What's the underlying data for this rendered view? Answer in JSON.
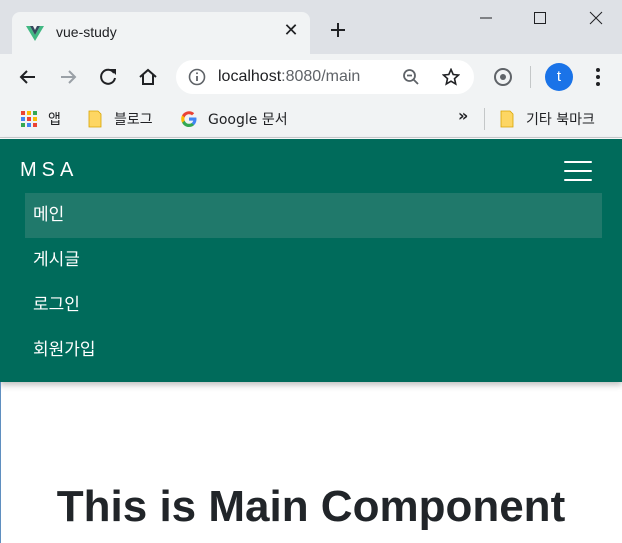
{
  "browser": {
    "tab": {
      "title": "vue-study",
      "close": "✕"
    },
    "new_tab": "+",
    "url": {
      "host": "localhost",
      "rest": ":8080/main"
    },
    "profile_initial": "t",
    "bookmarks": {
      "apps": "앱",
      "blog": "블로그",
      "google_docs": "Google 문서",
      "more": "»",
      "other": "기타 북마크"
    },
    "colors": {
      "frame": "#dee1e6",
      "toolbar": "#f1f3f4",
      "profile": "#1a73e8"
    }
  },
  "page": {
    "brand": "MSA",
    "nav": [
      {
        "label": "메인",
        "active": true
      },
      {
        "label": "게시글",
        "active": false
      },
      {
        "label": "로그인",
        "active": false
      },
      {
        "label": "회원가입",
        "active": false
      }
    ],
    "title": "This is Main Component",
    "colors": {
      "navbar": "#006b5b",
      "active_item": "#20796b",
      "title": "#212529"
    }
  }
}
